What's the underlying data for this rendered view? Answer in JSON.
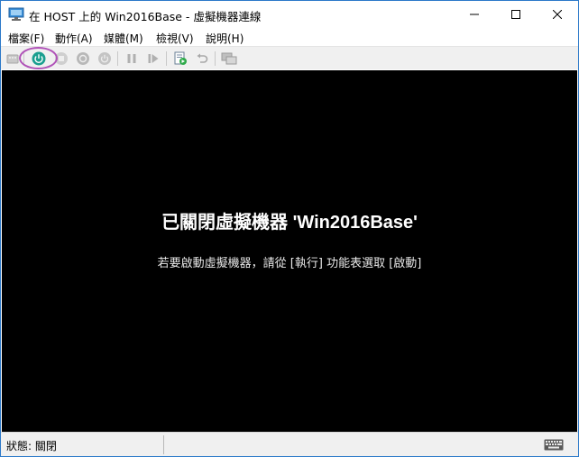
{
  "window": {
    "title": "在 HOST 上的 Win2016Base - 虛擬機器連線",
    "app_icon": "vm-connection-icon",
    "controls": [
      "minimize-icon",
      "maximize-icon",
      "close-icon"
    ]
  },
  "menu": {
    "items": [
      {
        "label": "檔案(F)"
      },
      {
        "label": "動作(A)"
      },
      {
        "label": "媒體(M)"
      },
      {
        "label": "檢視(V)"
      },
      {
        "label": "說明(H)"
      }
    ]
  },
  "toolbar": {
    "buttons": [
      {
        "icon": "ctrl-alt-del-icon",
        "enabled": false
      },
      {
        "icon": "start-icon",
        "enabled": true,
        "highlighted": true
      },
      {
        "icon": "turn-off-icon",
        "enabled": false
      },
      {
        "icon": "shut-down-icon",
        "enabled": false
      },
      {
        "icon": "save-icon",
        "enabled": false
      },
      {
        "icon": "pause-icon",
        "enabled": false
      },
      {
        "icon": "resume-icon",
        "enabled": false
      },
      {
        "icon": "checkpoint-icon",
        "enabled": true
      },
      {
        "icon": "revert-icon",
        "enabled": false
      },
      {
        "icon": "enhanced-session-icon",
        "enabled": false
      }
    ],
    "highlight_color": "#b052b8",
    "start_color": "#1a9e8f"
  },
  "console": {
    "heading": "已關閉虛擬機器 'Win2016Base'",
    "hint": "若要啟動虛擬機器，請從 [執行] 功能表選取 [啟動]",
    "background": "#000000"
  },
  "status": {
    "text": "狀態: 關閉",
    "keyboard_icon": "keyboard-icon"
  }
}
